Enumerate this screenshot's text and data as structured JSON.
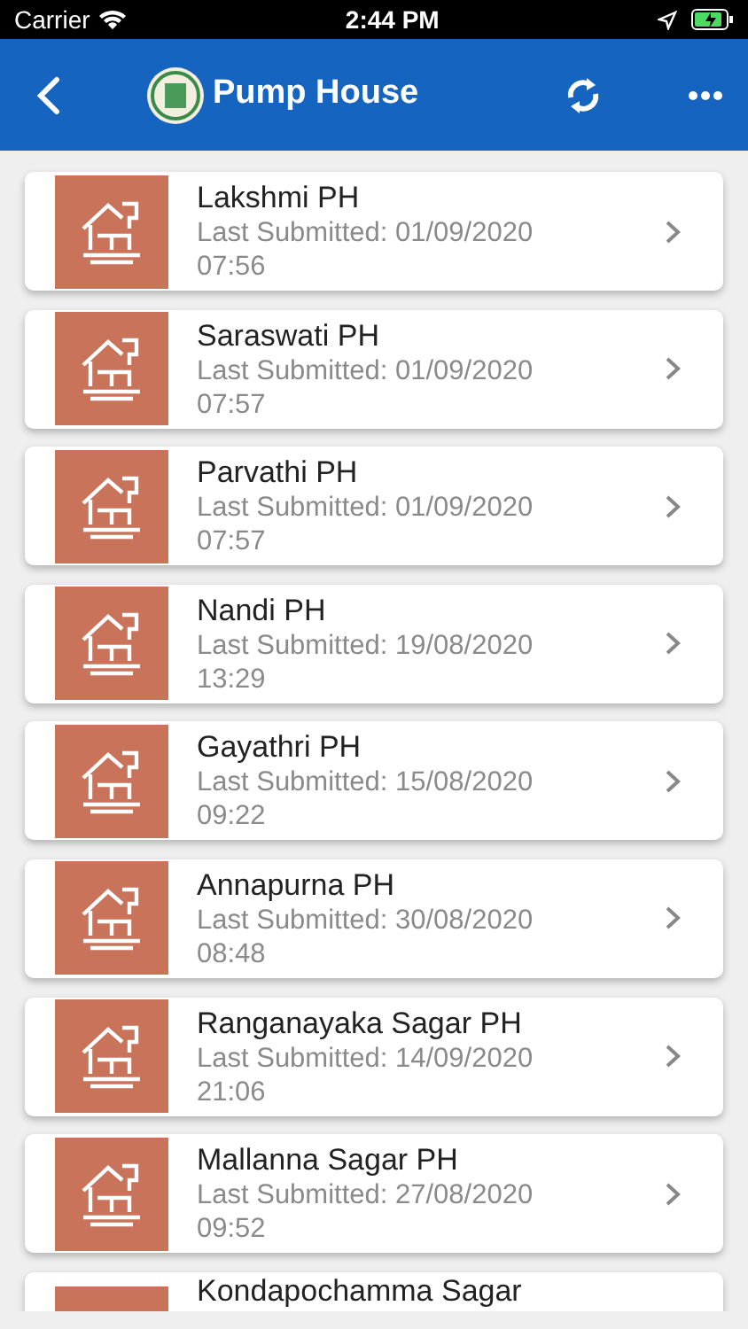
{
  "status_bar": {
    "carrier": "Carrier",
    "time": "2:44 PM"
  },
  "header": {
    "title": "Pump House"
  },
  "items": [
    {
      "name": "Lakshmi PH",
      "submitted": "Last Submitted: 01/09/2020",
      "time": "07:56"
    },
    {
      "name": "Saraswati PH",
      "submitted": "Last Submitted: 01/09/2020",
      "time": "07:57"
    },
    {
      "name": "Parvathi PH",
      "submitted": "Last Submitted: 01/09/2020",
      "time": "07:57"
    },
    {
      "name": "Nandi PH",
      "submitted": "Last Submitted: 19/08/2020",
      "time": "13:29"
    },
    {
      "name": "Gayathri PH",
      "submitted": "Last Submitted: 15/08/2020",
      "time": "09:22"
    },
    {
      "name": "Annapurna PH",
      "submitted": "Last Submitted: 30/08/2020",
      "time": "08:48"
    },
    {
      "name": "Ranganayaka Sagar PH",
      "submitted": "Last Submitted: 14/09/2020",
      "time": "21:06"
    },
    {
      "name": "Mallanna Sagar PH",
      "submitted": "Last Submitted: 27/08/2020",
      "time": "09:52"
    },
    {
      "name": "Kondapochamma Sagar"
    }
  ]
}
